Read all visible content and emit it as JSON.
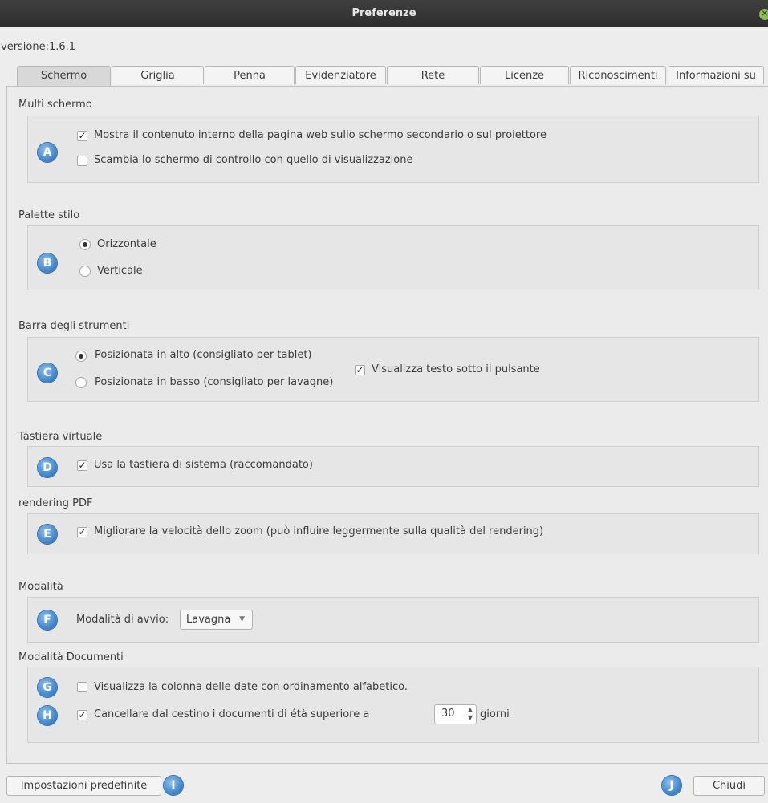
{
  "window": {
    "title": "Preferenze"
  },
  "version": "versione:1.6.1",
  "tabs": [
    "Schermo",
    "Griglia",
    "Penna",
    "Evidenziatore",
    "Rete",
    "Licenze",
    "Riconoscimenti",
    "Informazioni su"
  ],
  "sections": {
    "multi_screen": {
      "title": "Multi schermo",
      "badge": "A",
      "options": [
        {
          "label": "Mostra il contenuto interno della pagina web sullo schermo secondario o sul proiettore",
          "checked": true
        },
        {
          "label": "Scambia lo schermo di controllo con quello di visualizzazione",
          "checked": false
        }
      ]
    },
    "palette": {
      "title": "Palette stilo",
      "badge": "B",
      "options": [
        {
          "label": "Orizzontale",
          "selected": true
        },
        {
          "label": "Verticale",
          "selected": false
        }
      ]
    },
    "toolbar": {
      "title": "Barra degli strumenti",
      "badge": "C",
      "options": [
        {
          "label": "Posizionata in alto (consigliato per tablet)",
          "selected": true
        },
        {
          "label": "Posizionata in basso (consigliato per lavagne)",
          "selected": false
        }
      ],
      "show_text": {
        "label": "Visualizza testo sotto il pulsante",
        "checked": true
      }
    },
    "keyboard": {
      "title": "Tastiera virtuale",
      "badge": "D",
      "option": {
        "label": "Usa la tastiera di sistema (raccomandato)",
        "checked": true
      }
    },
    "pdf": {
      "title": "rendering PDF",
      "badge": "E",
      "option": {
        "label": "Migliorare la velocità dello zoom (può influire leggermente sulla qualità del rendering)",
        "checked": true
      }
    },
    "mode": {
      "title": "Modalità",
      "badge": "F",
      "start_label": "Modalità di avvio:",
      "start_value": "Lavagna"
    },
    "documents": {
      "title": "Modalità Documenti",
      "badge_g": "G",
      "badge_h": "H",
      "show_dates": {
        "label": "Visualizza la colonna delle date con ordinamento alfabetico.",
        "checked": false
      },
      "trash": {
        "label": "Cancellare dal cestino i documenti di étà superiore a",
        "checked": true,
        "days": "30",
        "unit": "giorni"
      }
    }
  },
  "footer": {
    "defaults_button": "Impostazioni predefinite",
    "badge_i": "I",
    "badge_j": "J",
    "close_button": "Chiudi"
  },
  "colors": {
    "badge": "#3a7fc6",
    "titlebar": "#333333",
    "close": "#8bbd56"
  },
  "check_mark": "✓"
}
